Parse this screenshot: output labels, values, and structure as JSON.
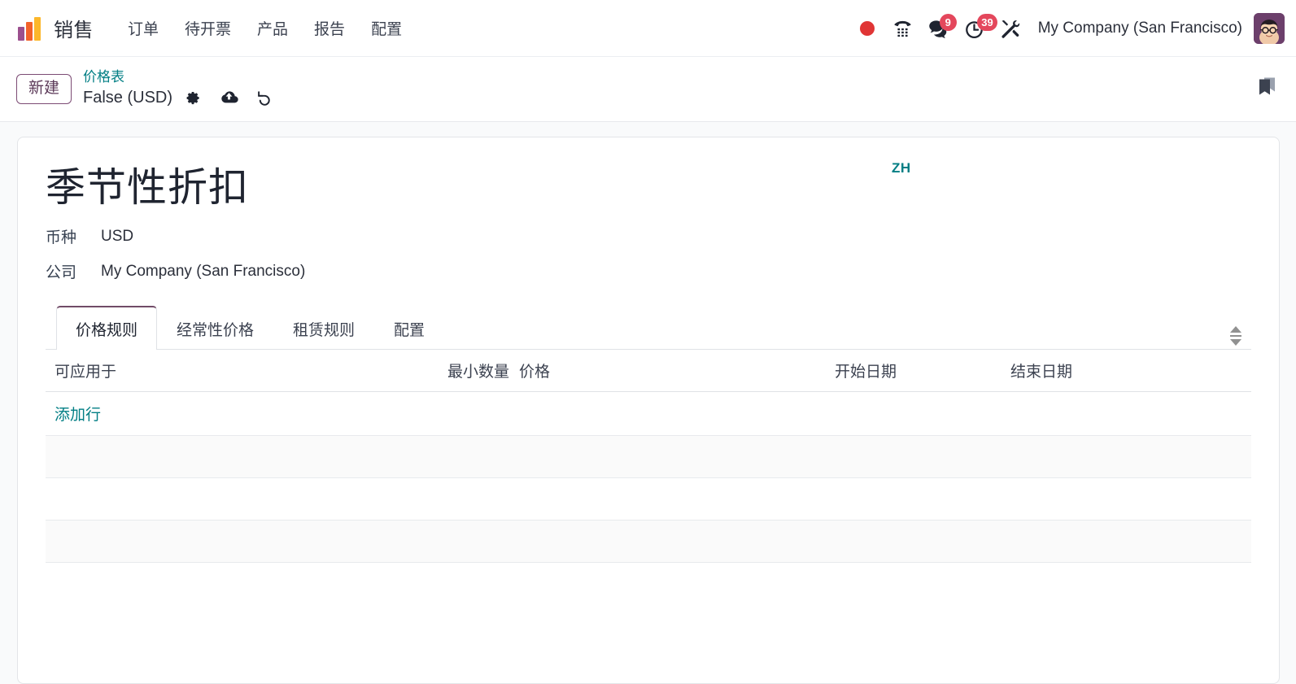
{
  "navbar": {
    "logo_icon": "sales-bars-logo",
    "app_name": "销售",
    "menu_items": [
      {
        "label": "订单",
        "name": "menu-orders"
      },
      {
        "label": "待开票",
        "name": "menu-to-invoice"
      },
      {
        "label": "产品",
        "name": "menu-products"
      },
      {
        "label": "报告",
        "name": "menu-reporting"
      },
      {
        "label": "配置",
        "name": "menu-configuration"
      }
    ],
    "icons": {
      "record_indicator": "record-dot-icon",
      "phone": "phone-dialpad-icon",
      "messages": "chat-bubbles-icon",
      "activities": "clock-activity-icon",
      "tools": "tools-wrench-icon"
    },
    "messages_count": "9",
    "activities_count": "39",
    "company": "My Company (San Francisco)",
    "avatar_alt": "user-avatar"
  },
  "control_panel": {
    "new_button": "新建",
    "breadcrumb_parent": "价格表",
    "breadcrumb_current": "False (USD)",
    "gear_icon": "gear-icon",
    "save_icon": "cloud-upload-icon",
    "discard_icon": "undo-icon",
    "bookmark_icon": "bookmark-icon"
  },
  "record": {
    "title": "季节性折扣",
    "lang_badge": "ZH",
    "fields": [
      {
        "label": "币种",
        "value": "USD",
        "name": "currency"
      },
      {
        "label": "公司",
        "value": "My Company (San Francisco)",
        "name": "company"
      }
    ]
  },
  "notebook": {
    "tabs": [
      {
        "label": "价格规则",
        "name": "tab-price-rules",
        "active": true
      },
      {
        "label": "经常性价格",
        "name": "tab-recurring-prices",
        "active": false
      },
      {
        "label": "租赁规则",
        "name": "tab-rental-rules",
        "active": false
      },
      {
        "label": "配置",
        "name": "tab-configuration",
        "active": false
      }
    ],
    "spinner_icon": "vertical-spinner-icon"
  },
  "list": {
    "columns": [
      {
        "label": "可应用于",
        "name": "column-applied-on"
      },
      {
        "label": "最小数量",
        "name": "column-min-quantity"
      },
      {
        "label": "价格",
        "name": "column-price"
      },
      {
        "label": "开始日期",
        "name": "column-start-date"
      },
      {
        "label": "结束日期",
        "name": "column-end-date"
      }
    ],
    "add_line_label": "添加行",
    "rows": [],
    "empty_filler_rows": 4
  },
  "colors": {
    "accent_teal": "#017e84",
    "accent_purple": "#714b67",
    "badge_red": "#e4475c",
    "record_red": "#e03535"
  }
}
